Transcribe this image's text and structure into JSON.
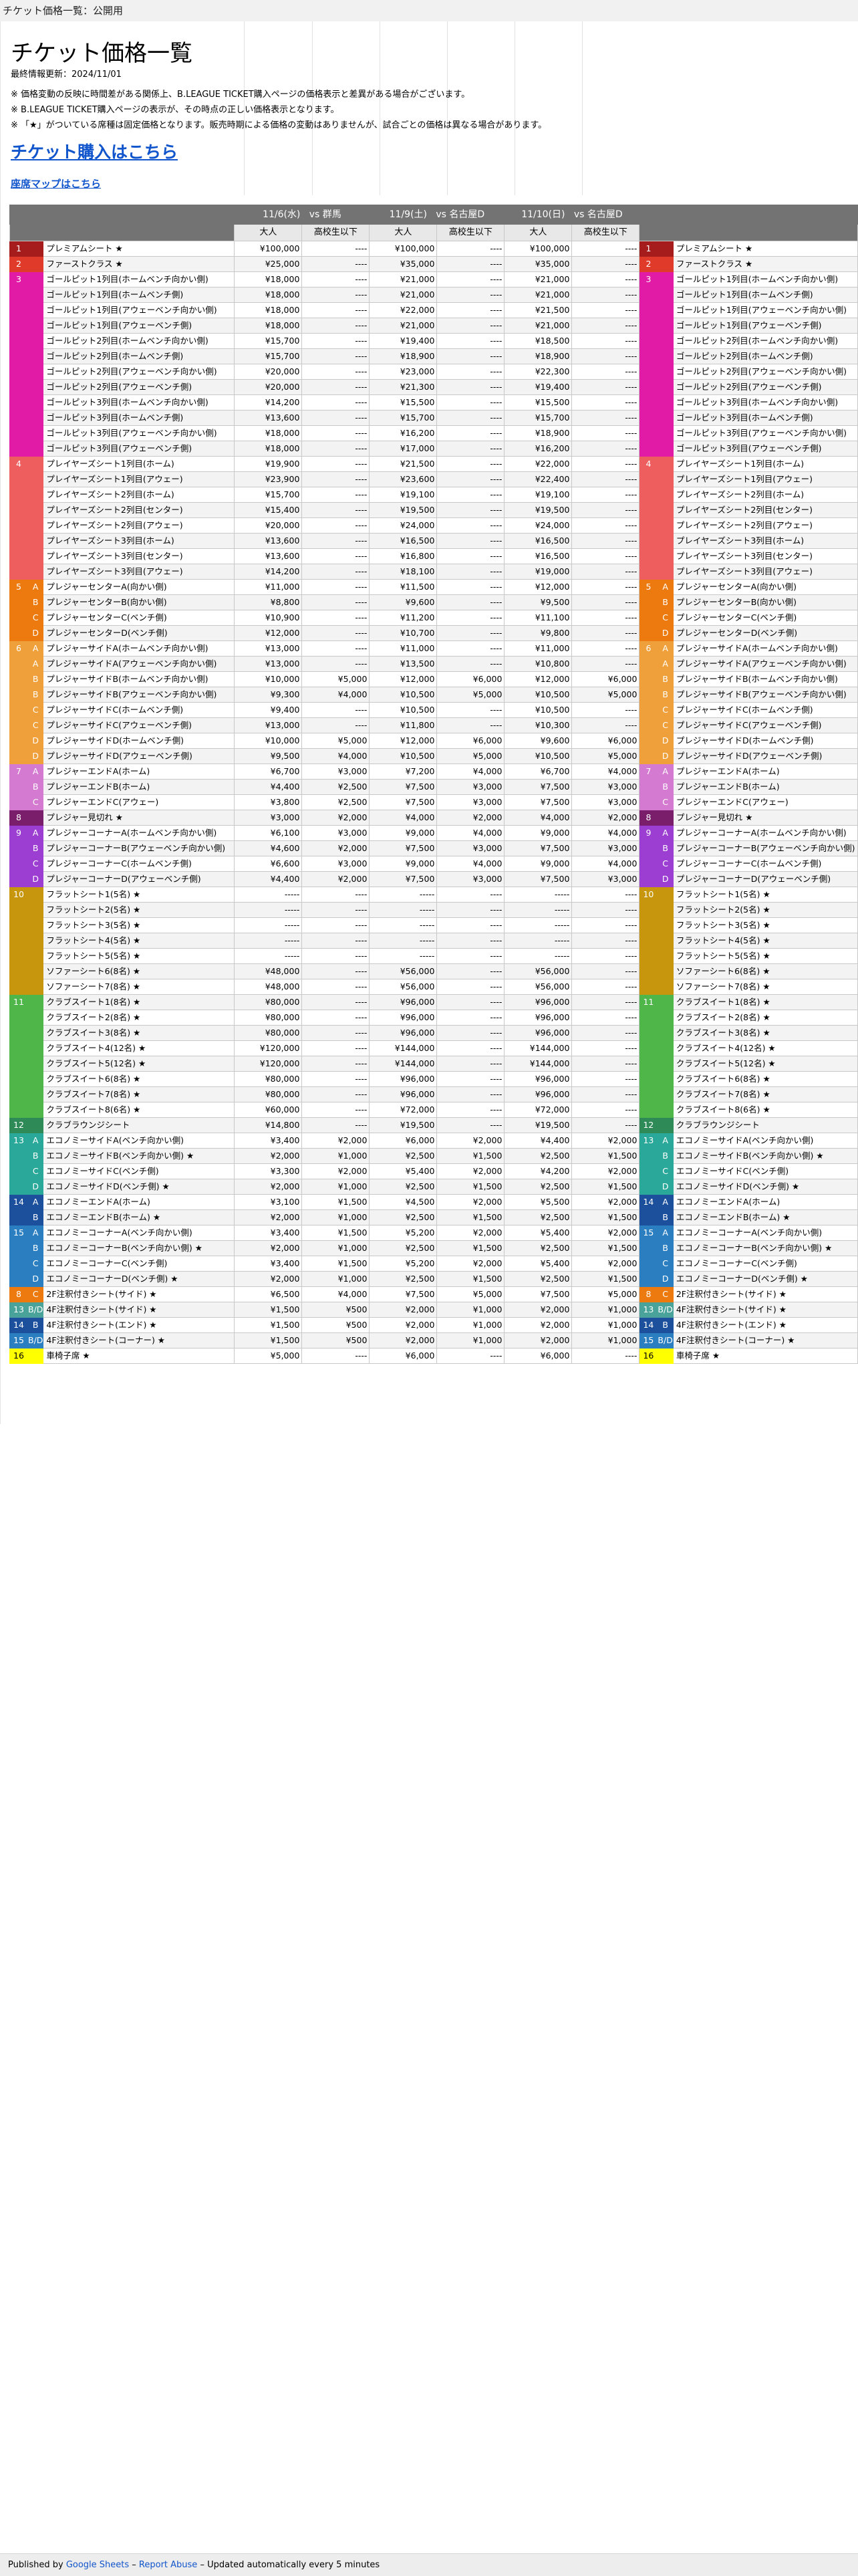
{
  "doc_title": "チケット価格一覧：公開用",
  "sheet": {
    "title": "チケット価格一覧",
    "updated": "最終情報更新：2024/11/01",
    "notes": [
      "※ 価格変動の反映に時間差がある関係上、B.LEAGUE TICKET購入ページの価格表示と差異がある場合がございます。",
      "※ B.LEAGUE TICKET購入ページの表示が、その時点の正しい価格表示となります。",
      "※ 「★」がついている席種は固定価格となります。販売時期による価格の変動はありませんが、試合ごとの価格は異なる場合があります。"
    ],
    "buy_link": "チケット購入はこちら",
    "map_link": "座席マップはこちら"
  },
  "games": [
    {
      "date": "11/6(水)",
      "opponent": "vs 群馬"
    },
    {
      "date": "11/9(土)",
      "opponent": "vs 名古屋D"
    },
    {
      "date": "11/10(日)",
      "opponent": "vs 名古屋D"
    }
  ],
  "subheaders": [
    "大人",
    "高校生以下"
  ],
  "colors": {
    "1": "#a61c1c",
    "2": "#e03b2a",
    "3": "#e11ba6",
    "4": "#ee5e5e",
    "5": "#ec7a0e",
    "6": "#efa03a",
    "7": "#d47ad1",
    "8": "#7a1d6b",
    "9": "#9b3ed1",
    "10": "#c8960c",
    "11": "#4fb64a",
    "12": "#2e8b57",
    "13": "#2aa89a",
    "14": "#1c4f9c",
    "15": "#2b7fc1",
    "16": "#ffff00",
    "13B": "#4aa39a"
  },
  "rows": [
    {
      "lvl": "1",
      "c": "1",
      "sub": "",
      "name": "プレミアムシート ★",
      "p": [
        "¥100,000",
        "----",
        "¥100,000",
        "----",
        "¥100,000",
        "----"
      ]
    },
    {
      "lvl": "2",
      "c": "2",
      "sub": "",
      "name": "ファーストクラス ★",
      "p": [
        "¥25,000",
        "----",
        "¥35,000",
        "----",
        "¥35,000",
        "----"
      ]
    },
    {
      "lvl": "3",
      "c": "3",
      "sub": "",
      "name": "ゴールピット1列目(ホームベンチ向かい側)",
      "p": [
        "¥18,000",
        "----",
        "¥21,000",
        "----",
        "¥21,000",
        "----"
      ]
    },
    {
      "lvl": "",
      "c": "3",
      "sub": "",
      "name": "ゴールピット1列目(ホームベンチ側)",
      "p": [
        "¥18,000",
        "----",
        "¥21,000",
        "----",
        "¥21,000",
        "----"
      ]
    },
    {
      "lvl": "",
      "c": "3",
      "sub": "",
      "name": "ゴールピット1列目(アウェーベンチ向かい側)",
      "p": [
        "¥18,000",
        "----",
        "¥22,000",
        "----",
        "¥21,500",
        "----"
      ]
    },
    {
      "lvl": "",
      "c": "3",
      "sub": "",
      "name": "ゴールピット1列目(アウェーベンチ側)",
      "p": [
        "¥18,000",
        "----",
        "¥21,000",
        "----",
        "¥21,000",
        "----"
      ]
    },
    {
      "lvl": "",
      "c": "3",
      "sub": "",
      "name": "ゴールピット2列目(ホームベンチ向かい側)",
      "p": [
        "¥15,700",
        "----",
        "¥19,400",
        "----",
        "¥18,500",
        "----"
      ]
    },
    {
      "lvl": "",
      "c": "3",
      "sub": "",
      "name": "ゴールピット2列目(ホームベンチ側)",
      "p": [
        "¥15,700",
        "----",
        "¥18,900",
        "----",
        "¥18,900",
        "----"
      ]
    },
    {
      "lvl": "",
      "c": "3",
      "sub": "",
      "name": "ゴールピット2列目(アウェーベンチ向かい側)",
      "p": [
        "¥20,000",
        "----",
        "¥23,000",
        "----",
        "¥22,300",
        "----"
      ]
    },
    {
      "lvl": "",
      "c": "3",
      "sub": "",
      "name": "ゴールピット2列目(アウェーベンチ側)",
      "p": [
        "¥20,000",
        "----",
        "¥21,300",
        "----",
        "¥19,400",
        "----"
      ]
    },
    {
      "lvl": "",
      "c": "3",
      "sub": "",
      "name": "ゴールピット3列目(ホームベンチ向かい側)",
      "p": [
        "¥14,200",
        "----",
        "¥15,500",
        "----",
        "¥15,500",
        "----"
      ]
    },
    {
      "lvl": "",
      "c": "3",
      "sub": "",
      "name": "ゴールピット3列目(ホームベンチ側)",
      "p": [
        "¥13,600",
        "----",
        "¥15,700",
        "----",
        "¥15,700",
        "----"
      ]
    },
    {
      "lvl": "",
      "c": "3",
      "sub": "",
      "name": "ゴールピット3列目(アウェーベンチ向かい側)",
      "p": [
        "¥18,000",
        "----",
        "¥16,200",
        "----",
        "¥18,900",
        "----"
      ]
    },
    {
      "lvl": "",
      "c": "3",
      "sub": "",
      "name": "ゴールピット3列目(アウェーベンチ側)",
      "p": [
        "¥18,000",
        "----",
        "¥17,000",
        "----",
        "¥16,200",
        "----"
      ]
    },
    {
      "lvl": "4",
      "c": "4",
      "sub": "",
      "name": "プレイヤーズシート1列目(ホーム)",
      "p": [
        "¥19,900",
        "----",
        "¥21,500",
        "----",
        "¥22,000",
        "----"
      ]
    },
    {
      "lvl": "",
      "c": "4",
      "sub": "",
      "name": "プレイヤーズシート1列目(アウェー)",
      "p": [
        "¥23,900",
        "----",
        "¥23,600",
        "----",
        "¥22,400",
        "----"
      ]
    },
    {
      "lvl": "",
      "c": "4",
      "sub": "",
      "name": "プレイヤーズシート2列目(ホーム)",
      "p": [
        "¥15,700",
        "----",
        "¥19,100",
        "----",
        "¥19,100",
        "----"
      ]
    },
    {
      "lvl": "",
      "c": "4",
      "sub": "",
      "name": "プレイヤーズシート2列目(センター)",
      "p": [
        "¥15,400",
        "----",
        "¥19,500",
        "----",
        "¥19,500",
        "----"
      ]
    },
    {
      "lvl": "",
      "c": "4",
      "sub": "",
      "name": "プレイヤーズシート2列目(アウェー)",
      "p": [
        "¥20,000",
        "----",
        "¥24,000",
        "----",
        "¥24,000",
        "----"
      ]
    },
    {
      "lvl": "",
      "c": "4",
      "sub": "",
      "name": "プレイヤーズシート3列目(ホーム)",
      "p": [
        "¥13,600",
        "----",
        "¥16,500",
        "----",
        "¥16,500",
        "----"
      ]
    },
    {
      "lvl": "",
      "c": "4",
      "sub": "",
      "name": "プレイヤーズシート3列目(センター)",
      "p": [
        "¥13,600",
        "----",
        "¥16,800",
        "----",
        "¥16,500",
        "----"
      ]
    },
    {
      "lvl": "",
      "c": "4",
      "sub": "",
      "name": "プレイヤーズシート3列目(アウェー)",
      "p": [
        "¥14,200",
        "----",
        "¥18,100",
        "----",
        "¥19,000",
        "----"
      ]
    },
    {
      "lvl": "5",
      "c": "5",
      "sub": "A",
      "name": "プレジャーセンターA(向かい側)",
      "p": [
        "¥11,000",
        "----",
        "¥11,500",
        "----",
        "¥12,000",
        "----"
      ]
    },
    {
      "lvl": "",
      "c": "5",
      "sub": "B",
      "name": "プレジャーセンターB(向かい側)",
      "p": [
        "¥8,800",
        "----",
        "¥9,600",
        "----",
        "¥9,500",
        "----"
      ]
    },
    {
      "lvl": "",
      "c": "5",
      "sub": "C",
      "name": "プレジャーセンターC(ベンチ側)",
      "p": [
        "¥10,900",
        "----",
        "¥11,200",
        "----",
        "¥11,100",
        "----"
      ]
    },
    {
      "lvl": "",
      "c": "5",
      "sub": "D",
      "name": "プレジャーセンターD(ベンチ側)",
      "p": [
        "¥12,000",
        "----",
        "¥10,700",
        "----",
        "¥9,800",
        "----"
      ]
    },
    {
      "lvl": "6",
      "c": "6",
      "sub": "A",
      "name": "プレジャーサイドA(ホームベンチ向かい側)",
      "p": [
        "¥13,000",
        "----",
        "¥11,000",
        "----",
        "¥11,000",
        "----"
      ]
    },
    {
      "lvl": "",
      "c": "6",
      "sub": "A",
      "name": "プレジャーサイドA(アウェーベンチ向かい側)",
      "p": [
        "¥13,000",
        "----",
        "¥13,500",
        "----",
        "¥10,800",
        "----"
      ]
    },
    {
      "lvl": "",
      "c": "6",
      "sub": "B",
      "name": "プレジャーサイドB(ホームベンチ向かい側)",
      "p": [
        "¥10,000",
        "¥5,000",
        "¥12,000",
        "¥6,000",
        "¥12,000",
        "¥6,000"
      ]
    },
    {
      "lvl": "",
      "c": "6",
      "sub": "B",
      "name": "プレジャーサイドB(アウェーベンチ向かい側)",
      "p": [
        "¥9,300",
        "¥4,000",
        "¥10,500",
        "¥5,000",
        "¥10,500",
        "¥5,000"
      ]
    },
    {
      "lvl": "",
      "c": "6",
      "sub": "C",
      "name": "プレジャーサイドC(ホームベンチ側)",
      "p": [
        "¥9,400",
        "----",
        "¥10,500",
        "----",
        "¥10,500",
        "----"
      ]
    },
    {
      "lvl": "",
      "c": "6",
      "sub": "C",
      "name": "プレジャーサイドC(アウェーベンチ側)",
      "p": [
        "¥13,000",
        "----",
        "¥11,800",
        "----",
        "¥10,300",
        "----"
      ]
    },
    {
      "lvl": "",
      "c": "6",
      "sub": "D",
      "name": "プレジャーサイドD(ホームベンチ側)",
      "p": [
        "¥10,000",
        "¥5,000",
        "¥12,000",
        "¥6,000",
        "¥9,600",
        "¥6,000"
      ]
    },
    {
      "lvl": "",
      "c": "6",
      "sub": "D",
      "name": "プレジャーサイドD(アウェーベンチ側)",
      "p": [
        "¥9,500",
        "¥4,000",
        "¥10,500",
        "¥5,000",
        "¥10,500",
        "¥5,000"
      ]
    },
    {
      "lvl": "7",
      "c": "7",
      "sub": "A",
      "name": "プレジャーエンドA(ホーム)",
      "p": [
        "¥6,700",
        "¥3,000",
        "¥7,200",
        "¥4,000",
        "¥6,700",
        "¥4,000"
      ]
    },
    {
      "lvl": "",
      "c": "7",
      "sub": "B",
      "name": "プレジャーエンドB(ホーム)",
      "p": [
        "¥4,400",
        "¥2,500",
        "¥7,500",
        "¥3,000",
        "¥7,500",
        "¥3,000"
      ]
    },
    {
      "lvl": "",
      "c": "7",
      "sub": "C",
      "name": "プレジャーエンドC(アウェー)",
      "p": [
        "¥3,800",
        "¥2,500",
        "¥7,500",
        "¥3,000",
        "¥7,500",
        "¥3,000"
      ]
    },
    {
      "lvl": "8",
      "c": "8",
      "sub": "",
      "name": "プレジャー見切れ ★",
      "p": [
        "¥3,000",
        "¥2,000",
        "¥4,000",
        "¥2,000",
        "¥4,000",
        "¥2,000"
      ]
    },
    {
      "lvl": "9",
      "c": "9",
      "sub": "A",
      "name": "プレジャーコーナーA(ホームベンチ向かい側)",
      "p": [
        "¥6,100",
        "¥3,000",
        "¥9,000",
        "¥4,000",
        "¥9,000",
        "¥4,000"
      ]
    },
    {
      "lvl": "",
      "c": "9",
      "sub": "B",
      "name": "プレジャーコーナーB(アウェーベンチ向かい側)",
      "p": [
        "¥4,600",
        "¥2,000",
        "¥7,500",
        "¥3,000",
        "¥7,500",
        "¥3,000"
      ]
    },
    {
      "lvl": "",
      "c": "9",
      "sub": "C",
      "name": "プレジャーコーナーC(ホームベンチ側)",
      "p": [
        "¥6,600",
        "¥3,000",
        "¥9,000",
        "¥4,000",
        "¥9,000",
        "¥4,000"
      ]
    },
    {
      "lvl": "",
      "c": "9",
      "sub": "D",
      "name": "プレジャーコーナーD(アウェーベンチ側)",
      "p": [
        "¥4,400",
        "¥2,000",
        "¥7,500",
        "¥3,000",
        "¥7,500",
        "¥3,000"
      ]
    },
    {
      "lvl": "10",
      "c": "10",
      "sub": "",
      "name": "フラットシート1(5名) ★",
      "p": [
        "-----",
        "----",
        "-----",
        "----",
        "-----",
        "----"
      ]
    },
    {
      "lvl": "",
      "c": "10",
      "sub": "",
      "name": "フラットシート2(5名) ★",
      "p": [
        "-----",
        "----",
        "-----",
        "----",
        "-----",
        "----"
      ]
    },
    {
      "lvl": "",
      "c": "10",
      "sub": "",
      "name": "フラットシート3(5名) ★",
      "p": [
        "-----",
        "----",
        "-----",
        "----",
        "-----",
        "----"
      ]
    },
    {
      "lvl": "",
      "c": "10",
      "sub": "",
      "name": "フラットシート4(5名) ★",
      "p": [
        "-----",
        "----",
        "-----",
        "----",
        "-----",
        "----"
      ]
    },
    {
      "lvl": "",
      "c": "10",
      "sub": "",
      "name": "フラットシート5(5名) ★",
      "p": [
        "-----",
        "----",
        "-----",
        "----",
        "-----",
        "----"
      ]
    },
    {
      "lvl": "",
      "c": "10",
      "sub": "",
      "name": "ソファーシート6(8名) ★",
      "p": [
        "¥48,000",
        "----",
        "¥56,000",
        "----",
        "¥56,000",
        "----"
      ]
    },
    {
      "lvl": "",
      "c": "10",
      "sub": "",
      "name": "ソファーシート7(8名) ★",
      "p": [
        "¥48,000",
        "----",
        "¥56,000",
        "----",
        "¥56,000",
        "----"
      ]
    },
    {
      "lvl": "11",
      "c": "11",
      "sub": "",
      "name": "クラブスイート1(8名) ★",
      "p": [
        "¥80,000",
        "----",
        "¥96,000",
        "----",
        "¥96,000",
        "----"
      ]
    },
    {
      "lvl": "",
      "c": "11",
      "sub": "",
      "name": "クラブスイート2(8名) ★",
      "p": [
        "¥80,000",
        "----",
        "¥96,000",
        "----",
        "¥96,000",
        "----"
      ]
    },
    {
      "lvl": "",
      "c": "11",
      "sub": "",
      "name": "クラブスイート3(8名) ★",
      "p": [
        "¥80,000",
        "----",
        "¥96,000",
        "----",
        "¥96,000",
        "----"
      ]
    },
    {
      "lvl": "",
      "c": "11",
      "sub": "",
      "name": "クラブスイート4(12名) ★",
      "p": [
        "¥120,000",
        "----",
        "¥144,000",
        "----",
        "¥144,000",
        "----"
      ]
    },
    {
      "lvl": "",
      "c": "11",
      "sub": "",
      "name": "クラブスイート5(12名) ★",
      "p": [
        "¥120,000",
        "----",
        "¥144,000",
        "----",
        "¥144,000",
        "----"
      ]
    },
    {
      "lvl": "",
      "c": "11",
      "sub": "",
      "name": "クラブスイート6(8名) ★",
      "p": [
        "¥80,000",
        "----",
        "¥96,000",
        "----",
        "¥96,000",
        "----"
      ]
    },
    {
      "lvl": "",
      "c": "11",
      "sub": "",
      "name": "クラブスイート7(8名) ★",
      "p": [
        "¥80,000",
        "----",
        "¥96,000",
        "----",
        "¥96,000",
        "----"
      ]
    },
    {
      "lvl": "",
      "c": "11",
      "sub": "",
      "name": "クラブスイート8(6名) ★",
      "p": [
        "¥60,000",
        "----",
        "¥72,000",
        "----",
        "¥72,000",
        "----"
      ]
    },
    {
      "lvl": "12",
      "c": "12",
      "sub": "",
      "name": "クラブラウンジシート",
      "p": [
        "¥14,800",
        "----",
        "¥19,500",
        "----",
        "¥19,500",
        "----"
      ]
    },
    {
      "lvl": "13",
      "c": "13",
      "sub": "A",
      "name": "エコノミーサイドA(ベンチ向かい側)",
      "p": [
        "¥3,400",
        "¥2,000",
        "¥6,000",
        "¥2,000",
        "¥4,400",
        "¥2,000"
      ]
    },
    {
      "lvl": "",
      "c": "13",
      "sub": "B",
      "name": "エコノミーサイドB(ベンチ向かい側) ★",
      "p": [
        "¥2,000",
        "¥1,000",
        "¥2,500",
        "¥1,500",
        "¥2,500",
        "¥1,500"
      ]
    },
    {
      "lvl": "",
      "c": "13",
      "sub": "C",
      "name": "エコノミーサイドC(ベンチ側)",
      "p": [
        "¥3,300",
        "¥2,000",
        "¥5,400",
        "¥2,000",
        "¥4,200",
        "¥2,000"
      ]
    },
    {
      "lvl": "",
      "c": "13",
      "sub": "D",
      "name": "エコノミーサイドD(ベンチ側) ★",
      "p": [
        "¥2,000",
        "¥1,000",
        "¥2,500",
        "¥1,500",
        "¥2,500",
        "¥1,500"
      ]
    },
    {
      "lvl": "14",
      "c": "14",
      "sub": "A",
      "name": "エコノミーエンドA(ホーム)",
      "p": [
        "¥3,100",
        "¥1,500",
        "¥4,500",
        "¥2,000",
        "¥5,500",
        "¥2,000"
      ]
    },
    {
      "lvl": "",
      "c": "14",
      "sub": "B",
      "name": "エコノミーエンドB(ホーム) ★",
      "p": [
        "¥2,000",
        "¥1,000",
        "¥2,500",
        "¥1,500",
        "¥2,500",
        "¥1,500"
      ]
    },
    {
      "lvl": "15",
      "c": "15",
      "sub": "A",
      "name": "エコノミーコーナーA(ベンチ向かい側)",
      "p": [
        "¥3,400",
        "¥1,500",
        "¥5,200",
        "¥2,000",
        "¥5,400",
        "¥2,000"
      ]
    },
    {
      "lvl": "",
      "c": "15",
      "sub": "B",
      "name": "エコノミーコーナーB(ベンチ向かい側) ★",
      "p": [
        "¥2,000",
        "¥1,000",
        "¥2,500",
        "¥1,500",
        "¥2,500",
        "¥1,500"
      ]
    },
    {
      "lvl": "",
      "c": "15",
      "sub": "C",
      "name": "エコノミーコーナーC(ベンチ側)",
      "p": [
        "¥3,400",
        "¥1,500",
        "¥5,200",
        "¥2,000",
        "¥5,400",
        "¥2,000"
      ]
    },
    {
      "lvl": "",
      "c": "15",
      "sub": "D",
      "name": "エコノミーコーナーD(ベンチ側) ★",
      "p": [
        "¥2,000",
        "¥1,000",
        "¥2,500",
        "¥1,500",
        "¥2,500",
        "¥1,500"
      ]
    },
    {
      "lvl": "8",
      "c": "5",
      "sub": "C",
      "name": "2F注釈付きシート(サイド) ★",
      "p": [
        "¥6,500",
        "¥4,000",
        "¥7,500",
        "¥5,000",
        "¥7,500",
        "¥5,000"
      ]
    },
    {
      "lvl": "13",
      "c": "13B",
      "sub": "B/D",
      "name": "4F注釈付きシート(サイド) ★",
      "p": [
        "¥1,500",
        "¥500",
        "¥2,000",
        "¥1,000",
        "¥2,000",
        "¥1,000"
      ]
    },
    {
      "lvl": "14",
      "c": "14",
      "sub": "B",
      "name": "4F注釈付きシート(エンド) ★",
      "p": [
        "¥1,500",
        "¥500",
        "¥2,000",
        "¥1,000",
        "¥2,000",
        "¥1,000"
      ]
    },
    {
      "lvl": "15",
      "c": "15",
      "sub": "B/D",
      "name": "4F注釈付きシート(コーナー) ★",
      "p": [
        "¥1,500",
        "¥500",
        "¥2,000",
        "¥1,000",
        "¥2,000",
        "¥1,000"
      ]
    },
    {
      "lvl": "16",
      "c": "16",
      "sub": "",
      "name": "車椅子席 ★",
      "p": [
        "¥5,000",
        "----",
        "¥6,000",
        "----",
        "¥6,000",
        "----"
      ]
    }
  ],
  "footer": {
    "published_by": "Published by",
    "google_sheets": "Google Sheets",
    "sep1": " – ",
    "report_abuse": "Report Abuse",
    "updated": " – Updated automatically every 5 minutes"
  }
}
